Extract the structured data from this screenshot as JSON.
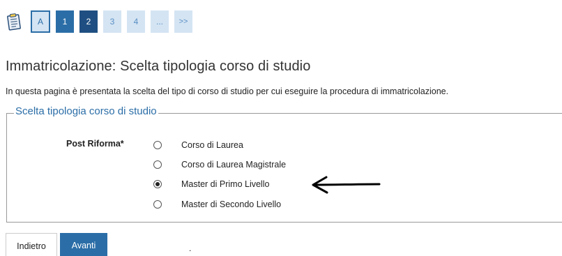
{
  "steps": {
    "icon": "clipboard-icon",
    "items": [
      {
        "label": "A",
        "state": "first"
      },
      {
        "label": "1",
        "state": "done"
      },
      {
        "label": "2",
        "state": "current"
      },
      {
        "label": "3",
        "state": "todo"
      },
      {
        "label": "4",
        "state": "todo"
      },
      {
        "label": "...",
        "state": "more"
      },
      {
        "label": ">>",
        "state": "next"
      }
    ]
  },
  "page": {
    "title": "Immatricolazione: Scelta tipologia corso di studio",
    "intro": "In questa pagina è presentata la scelta del tipo di corso di studio per cui eseguire la procedura di immatricolazione."
  },
  "form": {
    "legend": "Scelta tipologia corso di studio",
    "field_label": "Post Riforma*",
    "options": [
      {
        "label": "Corso di Laurea",
        "selected": false
      },
      {
        "label": "Corso di Laurea Magistrale",
        "selected": false
      },
      {
        "label": "Master di Primo Livello",
        "selected": true
      },
      {
        "label": "Master di Secondo Livello",
        "selected": false
      }
    ],
    "annotation_icon": "arrow-left-icon"
  },
  "buttons": {
    "back_label": "Indietro",
    "next_label": "Avanti"
  },
  "stray_text": ".",
  "colors": {
    "primary": "#2b6ea7",
    "primary_dark": "#1f4f82",
    "step_light": "#d4e4f3",
    "legend": "#2b6ea7"
  }
}
